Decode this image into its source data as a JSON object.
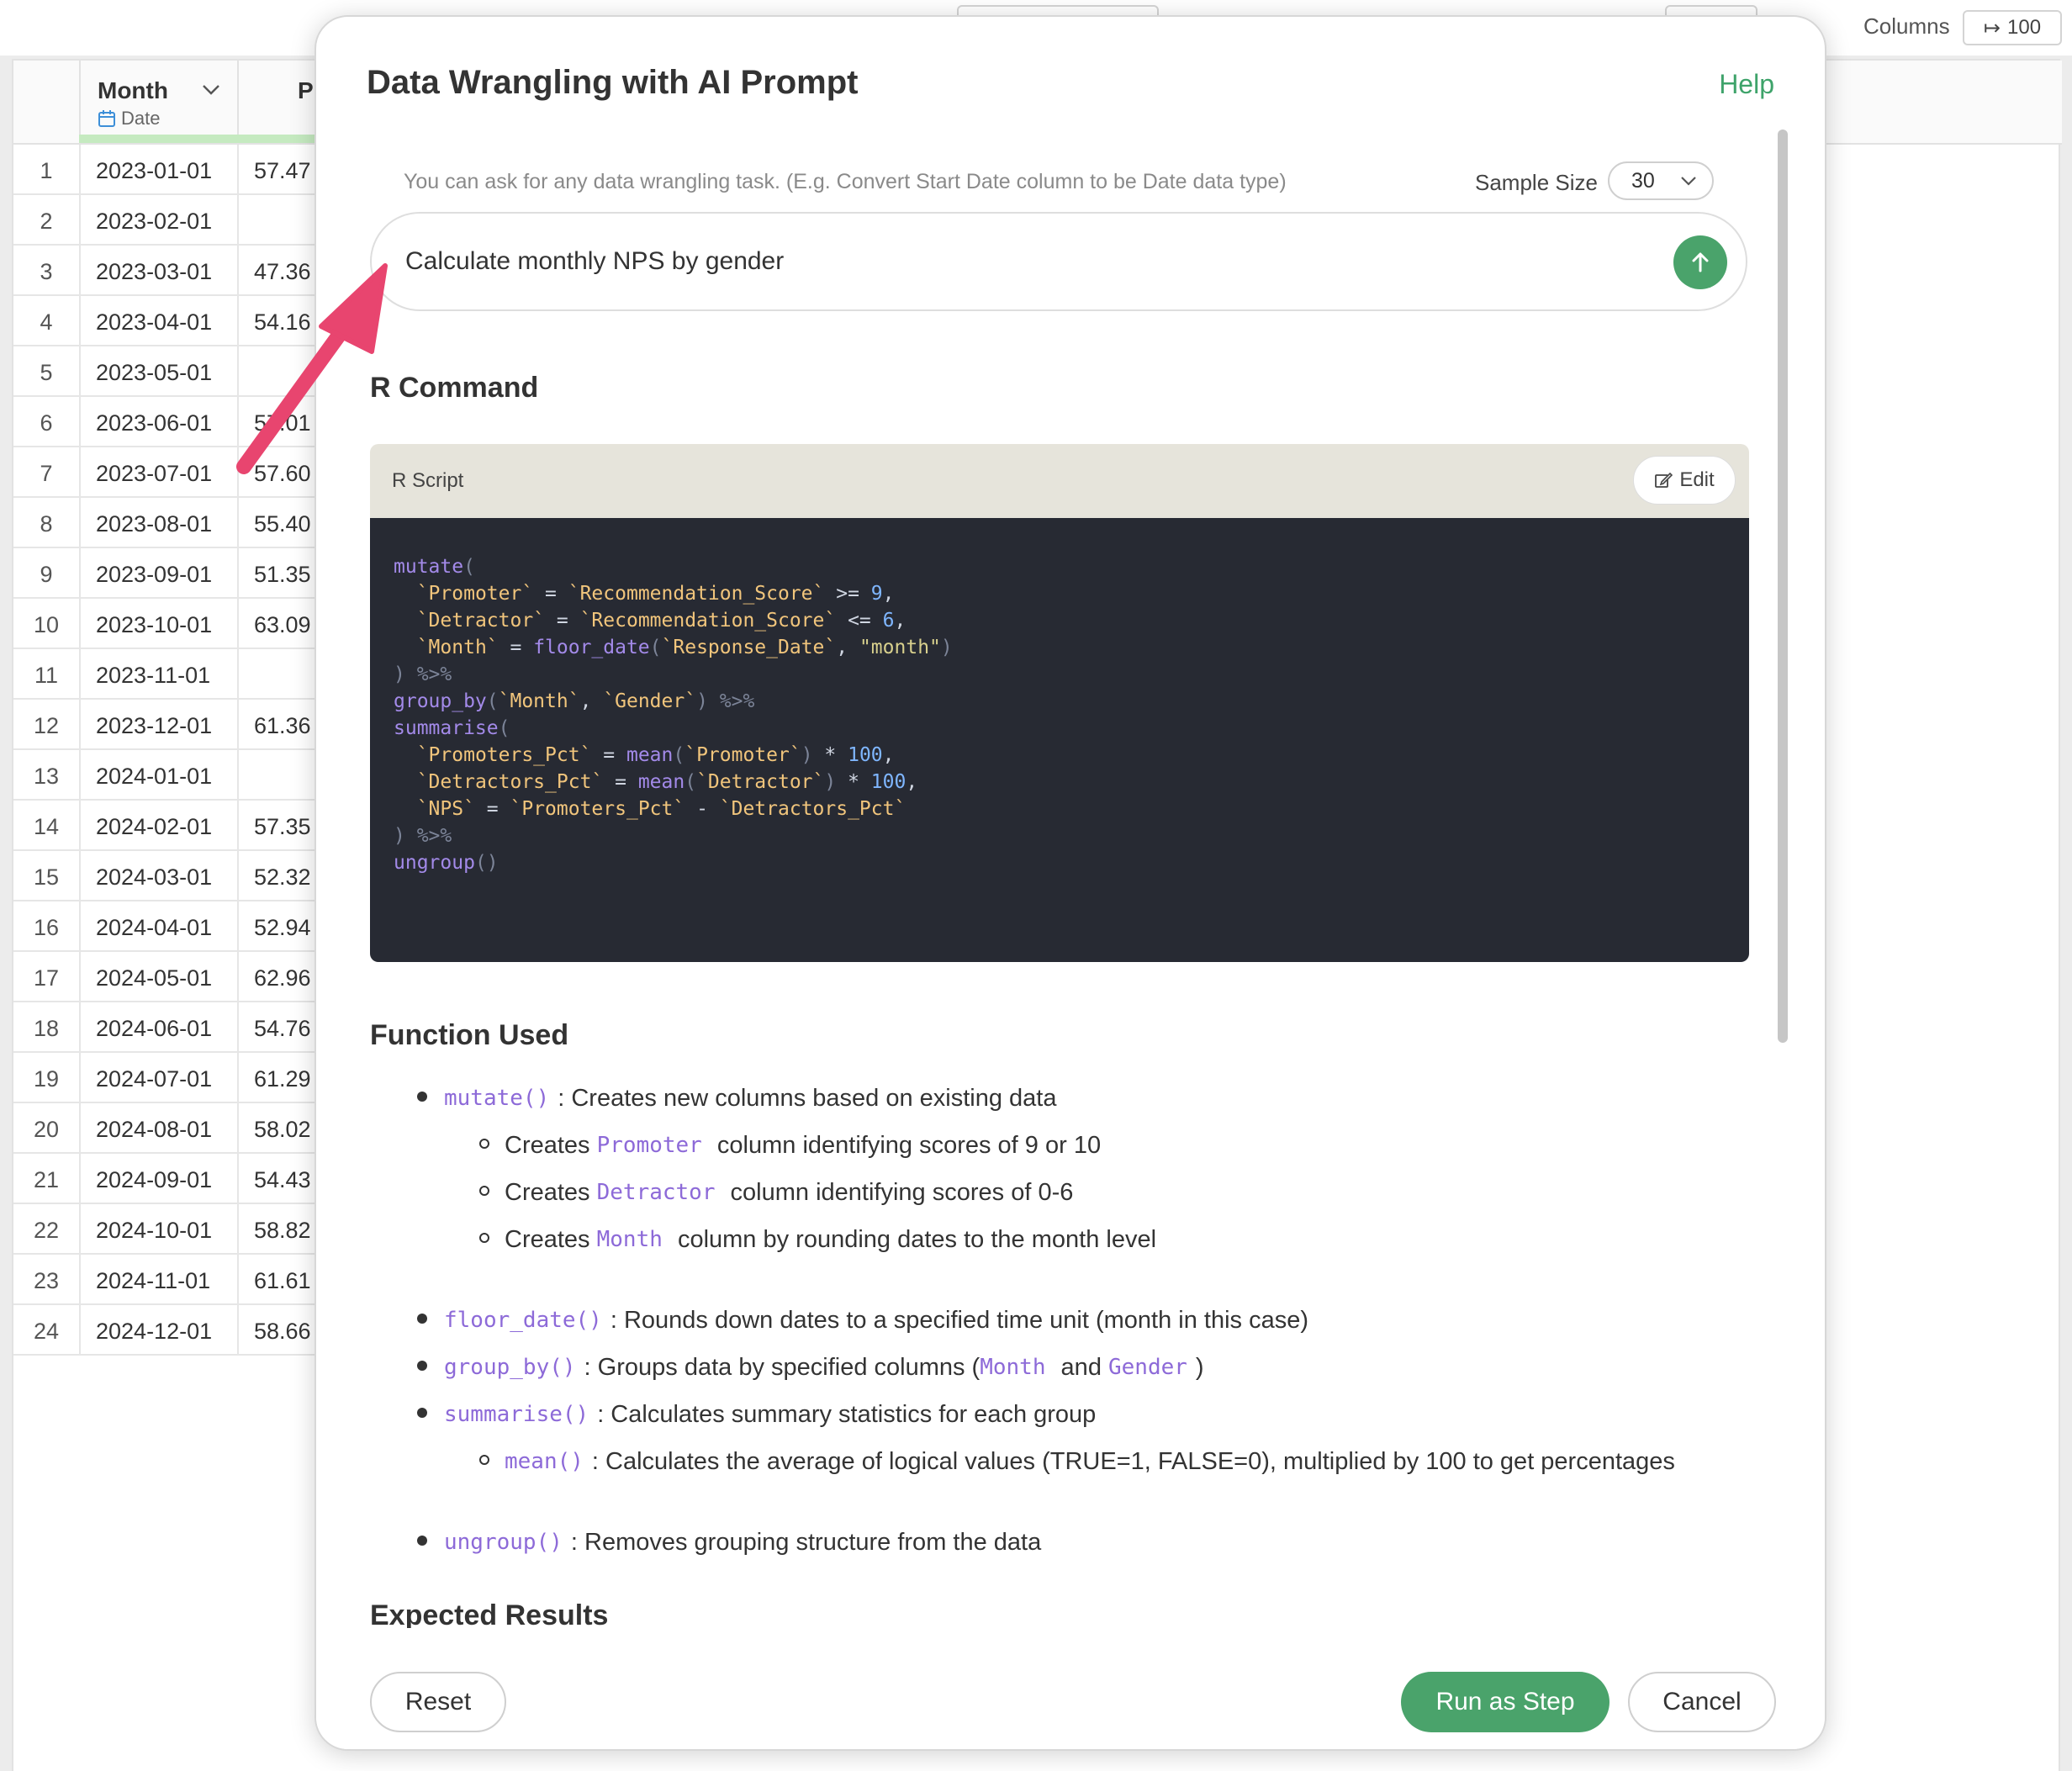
{
  "toolbar": {
    "columns_label": "Columns",
    "columns_value": "100"
  },
  "grid": {
    "month_header": "Month",
    "month_type": "Date",
    "pr_header": "Pr",
    "rows": [
      {
        "n": "1",
        "month": "2023-01-01",
        "pr": "57.47"
      },
      {
        "n": "2",
        "month": "2023-02-01",
        "pr": ""
      },
      {
        "n": "3",
        "month": "2023-03-01",
        "pr": "47.36"
      },
      {
        "n": "4",
        "month": "2023-04-01",
        "pr": "54.16"
      },
      {
        "n": "5",
        "month": "2023-05-01",
        "pr": ""
      },
      {
        "n": "6",
        "month": "2023-06-01",
        "pr": "57.01"
      },
      {
        "n": "7",
        "month": "2023-07-01",
        "pr": "57.60"
      },
      {
        "n": "8",
        "month": "2023-08-01",
        "pr": "55.40"
      },
      {
        "n": "9",
        "month": "2023-09-01",
        "pr": "51.35"
      },
      {
        "n": "10",
        "month": "2023-10-01",
        "pr": "63.09"
      },
      {
        "n": "11",
        "month": "2023-11-01",
        "pr": ""
      },
      {
        "n": "12",
        "month": "2023-12-01",
        "pr": "61.36"
      },
      {
        "n": "13",
        "month": "2024-01-01",
        "pr": ""
      },
      {
        "n": "14",
        "month": "2024-02-01",
        "pr": "57.35"
      },
      {
        "n": "15",
        "month": "2024-03-01",
        "pr": "52.32"
      },
      {
        "n": "16",
        "month": "2024-04-01",
        "pr": "52.94"
      },
      {
        "n": "17",
        "month": "2024-05-01",
        "pr": "62.96"
      },
      {
        "n": "18",
        "month": "2024-06-01",
        "pr": "54.76"
      },
      {
        "n": "19",
        "month": "2024-07-01",
        "pr": "61.29"
      },
      {
        "n": "20",
        "month": "2024-08-01",
        "pr": "58.02"
      },
      {
        "n": "21",
        "month": "2024-09-01",
        "pr": "54.43"
      },
      {
        "n": "22",
        "month": "2024-10-01",
        "pr": "58.82"
      },
      {
        "n": "23",
        "month": "2024-11-01",
        "pr": "61.61"
      },
      {
        "n": "24",
        "month": "2024-12-01",
        "pr": "58.66"
      }
    ]
  },
  "modal": {
    "title": "Data Wrangling with AI Prompt",
    "help": "Help",
    "hint": "You can ask for any data wrangling task. (E.g. Convert Start Date column to be Date data type)",
    "sample_size_label": "Sample Size",
    "sample_size_value": "30",
    "prompt": "Calculate monthly NPS by gender",
    "r_command_heading": "R Command",
    "script_label": "R Script",
    "edit_label": "Edit",
    "code_lines": [
      [
        [
          "fn",
          "mutate"
        ],
        [
          "pun",
          "("
        ]
      ],
      [
        [
          "sp",
          "  "
        ],
        [
          "id",
          "`Promoter`"
        ],
        [
          "op",
          " = "
        ],
        [
          "id",
          "`Recommendation_Score`"
        ],
        [
          "op",
          " >= "
        ],
        [
          "num",
          "9"
        ],
        [
          "op",
          ","
        ]
      ],
      [
        [
          "sp",
          "  "
        ],
        [
          "id",
          "`Detractor`"
        ],
        [
          "op",
          " = "
        ],
        [
          "id",
          "`Recommendation_Score`"
        ],
        [
          "op",
          " <= "
        ],
        [
          "num",
          "6"
        ],
        [
          "op",
          ","
        ]
      ],
      [
        [
          "sp",
          "  "
        ],
        [
          "id",
          "`Month`"
        ],
        [
          "op",
          " = "
        ],
        [
          "fn",
          "floor_date"
        ],
        [
          "pun",
          "("
        ],
        [
          "id",
          "`Response_Date`"
        ],
        [
          "op",
          ", "
        ],
        [
          "str",
          "\"month\""
        ],
        [
          "pun",
          ")"
        ]
      ],
      [
        [
          "pun",
          ") %>%"
        ]
      ],
      [
        [
          "fn",
          "group_by"
        ],
        [
          "pun",
          "("
        ],
        [
          "id",
          "`Month`"
        ],
        [
          "op",
          ", "
        ],
        [
          "id",
          "`Gender`"
        ],
        [
          "pun",
          ") %>%"
        ]
      ],
      [
        [
          "fn",
          "summarise"
        ],
        [
          "pun",
          "("
        ]
      ],
      [
        [
          "sp",
          "  "
        ],
        [
          "id",
          "`Promoters_Pct`"
        ],
        [
          "op",
          " = "
        ],
        [
          "fn",
          "mean"
        ],
        [
          "pun",
          "("
        ],
        [
          "id",
          "`Promoter`"
        ],
        [
          "pun",
          ")"
        ],
        [
          "op",
          " * "
        ],
        [
          "num",
          "100"
        ],
        [
          "op",
          ","
        ]
      ],
      [
        [
          "sp",
          "  "
        ],
        [
          "id",
          "`Detractors_Pct`"
        ],
        [
          "op",
          " = "
        ],
        [
          "fn",
          "mean"
        ],
        [
          "pun",
          "("
        ],
        [
          "id",
          "`Detractor`"
        ],
        [
          "pun",
          ")"
        ],
        [
          "op",
          " * "
        ],
        [
          "num",
          "100"
        ],
        [
          "op",
          ","
        ]
      ],
      [
        [
          "sp",
          "  "
        ],
        [
          "id",
          "`NPS`"
        ],
        [
          "op",
          " = "
        ],
        [
          "id",
          "`Promoters_Pct`"
        ],
        [
          "op",
          " - "
        ],
        [
          "id",
          "`Detractors_Pct`"
        ]
      ],
      [
        [
          "pun",
          ") %>%"
        ]
      ],
      [
        [
          "fn",
          "ungroup"
        ],
        [
          "pun",
          "()"
        ]
      ]
    ],
    "function_used_heading": "Function Used",
    "functions": [
      {
        "level": 1,
        "parts": [
          [
            "code",
            "mutate()"
          ],
          [
            "text",
            ": Creates new columns based on existing data"
          ]
        ]
      },
      {
        "level": 2,
        "parts": [
          [
            "text",
            "Creates "
          ],
          [
            "code",
            "Promoter"
          ],
          [
            "text",
            " column identifying scores of 9 or 10"
          ]
        ]
      },
      {
        "level": 2,
        "parts": [
          [
            "text",
            "Creates "
          ],
          [
            "code",
            "Detractor"
          ],
          [
            "text",
            " column identifying scores of 0-6"
          ]
        ]
      },
      {
        "level": 2,
        "parts": [
          [
            "text",
            "Creates "
          ],
          [
            "code",
            "Month"
          ],
          [
            "text",
            " column by rounding dates to the month level"
          ]
        ]
      },
      {
        "level": 0
      },
      {
        "level": 1,
        "parts": [
          [
            "code",
            "floor_date()"
          ],
          [
            "text",
            ": Rounds down dates to a specified time unit (month in this case)"
          ]
        ]
      },
      {
        "level": 1,
        "parts": [
          [
            "code",
            "group_by()"
          ],
          [
            "text",
            ": Groups data by specified columns ("
          ],
          [
            "code",
            "Month"
          ],
          [
            "text",
            " and "
          ],
          [
            "code",
            "Gender"
          ],
          [
            "text",
            ")"
          ]
        ]
      },
      {
        "level": 1,
        "parts": [
          [
            "code",
            "summarise()"
          ],
          [
            "text",
            ": Calculates summary statistics for each group"
          ]
        ]
      },
      {
        "level": 2,
        "parts": [
          [
            "code",
            "mean()"
          ],
          [
            "text",
            ": Calculates the average of logical values (TRUE=1, FALSE=0), multiplied by 100 to get percentages"
          ]
        ]
      },
      {
        "level": 0
      },
      {
        "level": 1,
        "parts": [
          [
            "code",
            "ungroup()"
          ],
          [
            "text",
            ": Removes grouping structure from the data"
          ]
        ]
      }
    ],
    "expected_heading": "Expected Results",
    "reset_label": "Reset",
    "run_label": "Run as Step",
    "cancel_label": "Cancel"
  },
  "colors": {
    "accent_green": "#4aa36b",
    "help_green": "#3ea36a",
    "arrow_pink": "#e8456f",
    "code_bg": "#272a33",
    "code_header_bg": "#e6e4db"
  },
  "icons": {
    "send": "arrow-up-icon",
    "edit": "edit-icon",
    "date_type": "calendar-icon",
    "sort": "chevron-down-icon"
  }
}
